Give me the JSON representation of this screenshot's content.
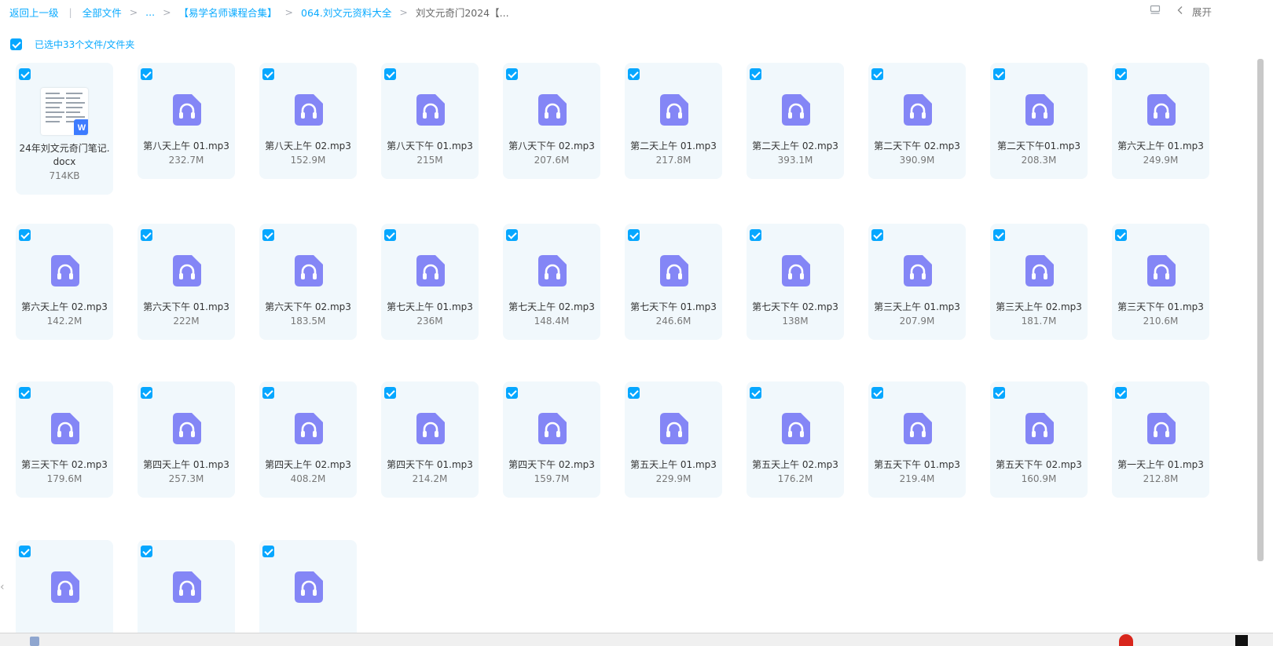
{
  "breadcrumb": {
    "back": "返回上一级",
    "sep": "|",
    "all_files": "全部文件",
    "gt": ">",
    "ellipsis": "...",
    "folder1": "【易学名师课程合集】",
    "folder2": "064.刘文元资料大全",
    "current": "刘文元奇门2024【..."
  },
  "toolbar": {
    "expand_label": "展开"
  },
  "selection": {
    "label": "已选中33个文件/文件夹",
    "checked": true
  },
  "accent_color": "#06a7ff",
  "audio_icon_color": "#8486f6",
  "files": [
    {
      "name": "24年刘文元奇门笔记.docx",
      "size": "714KB",
      "type": "docx"
    },
    {
      "name": "第八天上午 01.mp3",
      "size": "232.7M",
      "type": "audio"
    },
    {
      "name": "第八天上午 02.mp3",
      "size": "152.9M",
      "type": "audio"
    },
    {
      "name": "第八天下午 01.mp3",
      "size": "215M",
      "type": "audio"
    },
    {
      "name": "第八天下午 02.mp3",
      "size": "207.6M",
      "type": "audio"
    },
    {
      "name": "第二天上午 01.mp3",
      "size": "217.8M",
      "type": "audio"
    },
    {
      "name": "第二天上午 02.mp3",
      "size": "393.1M",
      "type": "audio"
    },
    {
      "name": "第二天下午 02.mp3",
      "size": "390.9M",
      "type": "audio"
    },
    {
      "name": "第二天下午01.mp3",
      "size": "208.3M",
      "type": "audio"
    },
    {
      "name": "第六天上午 01.mp3",
      "size": "249.9M",
      "type": "audio"
    },
    {
      "name": "第六天上午 02.mp3",
      "size": "142.2M",
      "type": "audio"
    },
    {
      "name": "第六天下午 01.mp3",
      "size": "222M",
      "type": "audio"
    },
    {
      "name": "第六天下午 02.mp3",
      "size": "183.5M",
      "type": "audio"
    },
    {
      "name": "第七天上午 01.mp3",
      "size": "236M",
      "type": "audio"
    },
    {
      "name": "第七天上午 02.mp3",
      "size": "148.4M",
      "type": "audio"
    },
    {
      "name": "第七天下午 01.mp3",
      "size": "246.6M",
      "type": "audio"
    },
    {
      "name": "第七天下午 02.mp3",
      "size": "138M",
      "type": "audio"
    },
    {
      "name": "第三天上午 01.mp3",
      "size": "207.9M",
      "type": "audio"
    },
    {
      "name": "第三天上午 02.mp3",
      "size": "181.7M",
      "type": "audio"
    },
    {
      "name": "第三天下午 01.mp3",
      "size": "210.6M",
      "type": "audio"
    },
    {
      "name": "第三天下午 02.mp3",
      "size": "179.6M",
      "type": "audio"
    },
    {
      "name": "第四天上午 01.mp3",
      "size": "257.3M",
      "type": "audio"
    },
    {
      "name": "第四天上午 02.mp3",
      "size": "408.2M",
      "type": "audio"
    },
    {
      "name": "第四天下午 01.mp3",
      "size": "214.2M",
      "type": "audio"
    },
    {
      "name": "第四天下午 02.mp3",
      "size": "159.7M",
      "type": "audio"
    },
    {
      "name": "第五天上午 01.mp3",
      "size": "229.9M",
      "type": "audio"
    },
    {
      "name": "第五天上午 02.mp3",
      "size": "176.2M",
      "type": "audio"
    },
    {
      "name": "第五天下午 01.mp3",
      "size": "219.4M",
      "type": "audio"
    },
    {
      "name": "第五天下午 02.mp3",
      "size": "160.9M",
      "type": "audio"
    },
    {
      "name": "第一天上午 01.mp3",
      "size": "212.8M",
      "type": "audio"
    },
    {
      "name": "",
      "size": "",
      "type": "audio"
    },
    {
      "name": "",
      "size": "",
      "type": "audio"
    },
    {
      "name": "",
      "size": "",
      "type": "audio"
    }
  ]
}
